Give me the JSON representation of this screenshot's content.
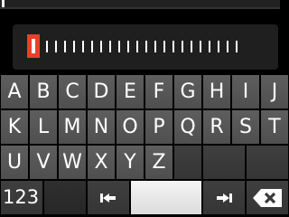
{
  "keyboard": {
    "row1": [
      "A",
      "B",
      "C",
      "D",
      "E",
      "F",
      "G",
      "H",
      "I",
      "J"
    ],
    "row2": [
      "K",
      "L",
      "M",
      "N",
      "O",
      "P",
      "Q",
      "R",
      "S",
      "T"
    ],
    "row3": [
      "U",
      "V",
      "W",
      "X",
      "Y",
      "Z"
    ],
    "numbers_key": "123"
  },
  "colors": {
    "cursor_marker": "#e8402a"
  }
}
